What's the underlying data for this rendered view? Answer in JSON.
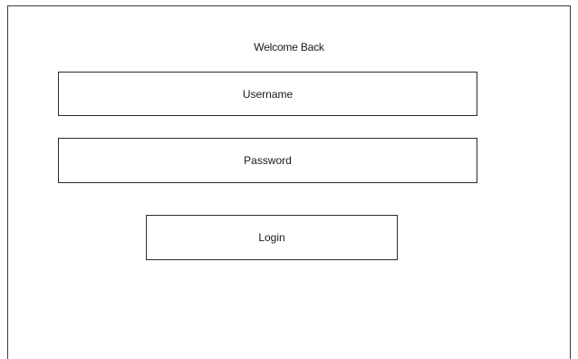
{
  "login_form": {
    "title": "Welcome Back",
    "username": {
      "placeholder": "Username",
      "value": ""
    },
    "password": {
      "placeholder": "Password",
      "value": ""
    },
    "login_button_label": "Login"
  }
}
